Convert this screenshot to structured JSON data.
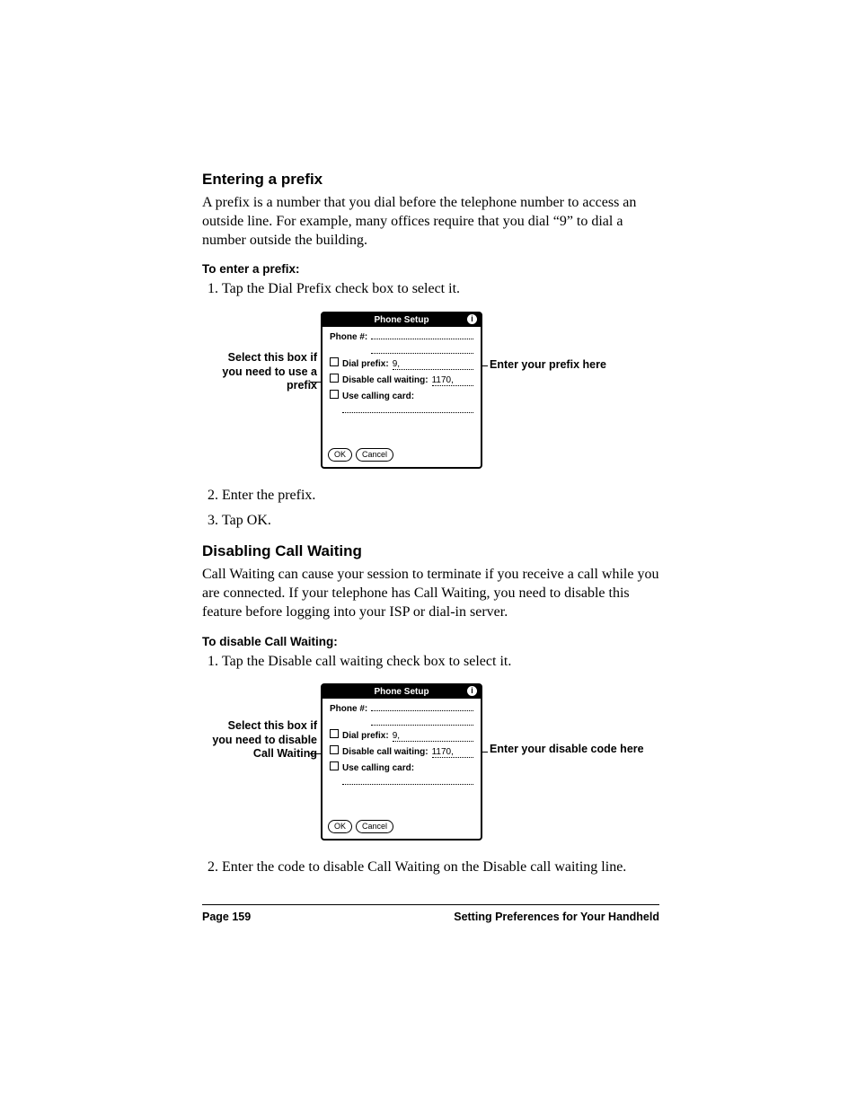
{
  "section1": {
    "heading": "Entering a prefix",
    "paragraph": "A prefix is a number that you dial before the telephone number to access an outside line. For example, many offices require that you dial “9” to dial a number outside the building.",
    "subhead": "To enter a prefix:",
    "steps": [
      "Tap the Dial Prefix check box to select it.",
      "Enter the prefix.",
      "Tap OK."
    ],
    "callout_left": "Select this box if you need to use a prefix",
    "callout_right": "Enter your prefix here"
  },
  "dialog": {
    "title": "Phone Setup",
    "info_glyph": "i",
    "phone_label": "Phone #:",
    "dial_prefix_label": "Dial prefix:",
    "dial_prefix_value": "9,",
    "disable_cw_label": "Disable call waiting:",
    "disable_cw_value": "1170,",
    "use_cc_label": "Use calling card:",
    "ok": "OK",
    "cancel": "Cancel"
  },
  "section2": {
    "heading": "Disabling Call Waiting",
    "paragraph": "Call Waiting can cause your session to terminate if you receive a call while you are connected. If your telephone has Call Waiting, you need to disable this feature before logging into your ISP or dial-in server.",
    "subhead": "To disable Call Waiting:",
    "steps_a": [
      "Tap the Disable call waiting check box to select it."
    ],
    "steps_b": [
      "Enter the code to disable Call Waiting on the Disable call waiting line."
    ],
    "callout_left": "Select this box if you need to disable Call Waiting",
    "callout_right": "Enter your disable code here"
  },
  "footer": {
    "page": "Page 159",
    "title": "Setting Preferences for Your Handheld"
  }
}
